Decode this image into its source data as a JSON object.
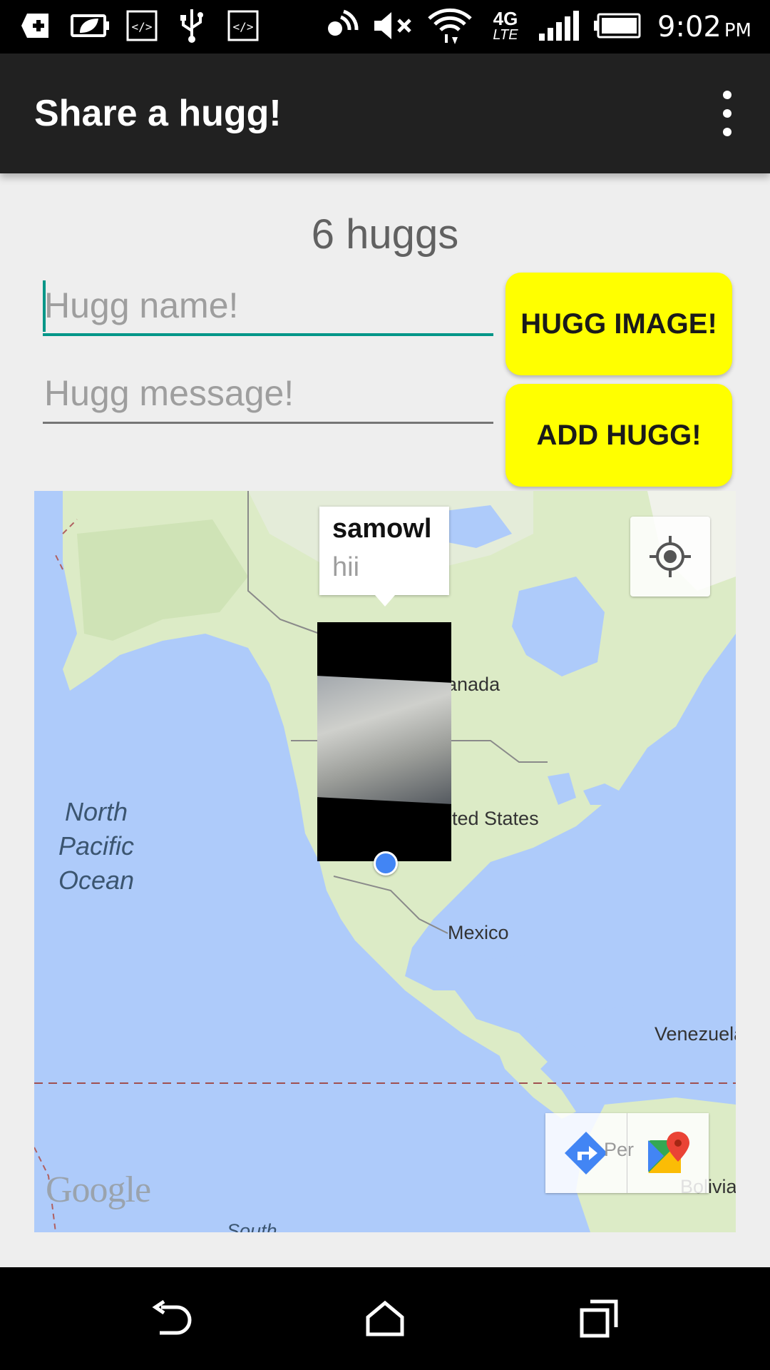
{
  "status_bar": {
    "time": "9:02",
    "ampm": "PM",
    "network": "4G",
    "network_sub": "LTE",
    "icons": [
      "plus-box-icon",
      "battery-saver-icon",
      "code-box-icon",
      "usb-icon",
      "code-box-icon",
      "nfc-icon",
      "mute-icon",
      "wifi-icon",
      "lte-icon",
      "signal-icon",
      "battery-icon"
    ]
  },
  "app_bar": {
    "title": "Share a hugg!"
  },
  "counter": {
    "text": "6 huggs"
  },
  "form": {
    "name_placeholder": "Hugg name!",
    "message_placeholder": "Hugg message!",
    "image_button": "HUGG IMAGE!",
    "add_button": "ADD HUGG!"
  },
  "map": {
    "labels": {
      "canada": "anada",
      "us": "ited States",
      "mexico": "Mexico",
      "venezuela": "Venezuela",
      "bolivia": "Bolivia",
      "peru": "Per",
      "south": "South",
      "ocean": [
        "North",
        "Pacific",
        "Ocean"
      ]
    },
    "info_window": {
      "title": "samowl",
      "snippet": "hii"
    },
    "google_logo": "Google"
  },
  "nav": {
    "buttons": [
      "back-icon",
      "home-icon",
      "recents-icon"
    ]
  },
  "colors": {
    "accent": "#009688",
    "button": "#ffff00",
    "app_bar": "#212121",
    "map_water": "#aecbfa"
  }
}
